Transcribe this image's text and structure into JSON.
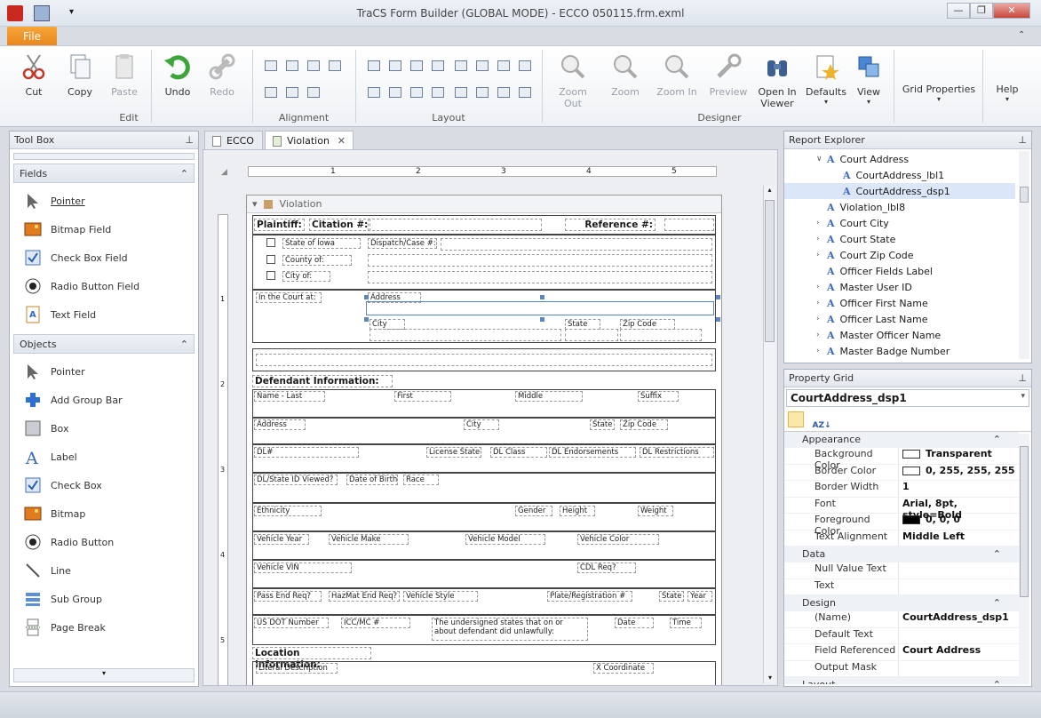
{
  "window": {
    "title": "TraCS Form Builder  (GLOBAL MODE) - ECCO 050115.frm.exml",
    "minimize": "—",
    "maximize": "❐",
    "close": "✕"
  },
  "file_tab": "File",
  "ribbon": {
    "buttons": [
      {
        "label": "Cut",
        "icon": "scissors-icon"
      },
      {
        "label": "Copy",
        "icon": "copy-icon"
      },
      {
        "label": "Paste",
        "icon": "paste-icon"
      },
      {
        "label": "Undo",
        "icon": "undo-icon"
      },
      {
        "label": "Redo",
        "icon": "redo-icon"
      },
      {
        "label": "Zoom Out",
        "icon": "zoom-out-icon"
      },
      {
        "label": "Zoom",
        "icon": "zoom-icon"
      },
      {
        "label": "Zoom In",
        "icon": "zoom-in-icon"
      },
      {
        "label": "Preview",
        "icon": "preview-icon"
      },
      {
        "label": "Open In Viewer",
        "icon": "binoculars-icon"
      },
      {
        "label": "Defaults",
        "icon": "defaults-icon"
      },
      {
        "label": "View",
        "icon": "view-icon"
      },
      {
        "label": "Grid Properties",
        "icon": ""
      },
      {
        "label": "Help",
        "icon": ""
      }
    ],
    "groups": [
      "Edit",
      "Alignment",
      "Layout",
      "Designer"
    ]
  },
  "toolbox": {
    "title": "Tool Box",
    "fields_header": "Fields",
    "fields": [
      {
        "label": "Pointer",
        "icon": "pointer-icon"
      },
      {
        "label": "Bitmap Field",
        "icon": "bitmap-icon"
      },
      {
        "label": "Check Box Field",
        "icon": "checkbox-icon"
      },
      {
        "label": "Radio Button Field",
        "icon": "radio-icon"
      },
      {
        "label": "Text Field",
        "icon": "text-field-icon"
      }
    ],
    "objects_header": "Objects",
    "objects": [
      {
        "label": "Pointer",
        "icon": "pointer-icon"
      },
      {
        "label": "Add Group Bar",
        "icon": "plus-icon"
      },
      {
        "label": "Box",
        "icon": "box-icon"
      },
      {
        "label": "Label",
        "icon": "label-icon"
      },
      {
        "label": "Check Box",
        "icon": "checkbox-icon"
      },
      {
        "label": "Bitmap",
        "icon": "bitmap-icon"
      },
      {
        "label": "Radio Button",
        "icon": "radio-icon"
      },
      {
        "label": "Line",
        "icon": "line-icon"
      },
      {
        "label": "Sub Group",
        "icon": "subgroup-icon"
      },
      {
        "label": "Page Break",
        "icon": "page-break-icon"
      }
    ]
  },
  "doc_tabs": [
    "ECCO",
    "Violation"
  ],
  "form": {
    "section_title": "Violation",
    "ruler_numbers": [
      "1",
      "2",
      "3",
      "4",
      "5"
    ],
    "vruler_numbers": [
      "1",
      "2",
      "3",
      "4",
      "5"
    ],
    "labels": {
      "plaintiff": "Plaintiff:",
      "citation": "Citation #:",
      "reference": "Reference #:",
      "state_of_iowa": "State of Iowa",
      "county_of": "County of:",
      "city_of": "City of:",
      "dispatch": "Dispatch/Case #:",
      "in_court_at": "In the Court at:",
      "address": "Address",
      "city": "City",
      "state": "State",
      "zip": "Zip Code",
      "defendant_info": "Defendant Information:",
      "name_last": "Name - Last",
      "first": "First",
      "middle": "Middle",
      "suffix": "Suffix",
      "def_address": "Address",
      "def_city": "City",
      "def_state": "State",
      "def_zip": "Zip Code",
      "dl": "DL#",
      "license_state": "License State",
      "dl_class": "DL Class",
      "dl_endorsements": "DL Endorsements",
      "dl_restrictions": "DL Restrictions",
      "dl_state_id": "DL/State ID Viewed?",
      "dob": "Date of Birth",
      "race": "Race",
      "ethnicity": "Ethnicity",
      "gender": "Gender",
      "height": "Height",
      "weight": "Weight",
      "vehicle_year": "Vehicle Year",
      "vehicle_make": "Vehicle Make",
      "vehicle_model": "Vehicle Model",
      "vehicle_color": "Vehicle Color",
      "vehicle_vin": "Vehicle VIN",
      "cdl_req": "CDL Req?",
      "pass_end": "Pass End Req?",
      "hazmat": "HazMat End Req?",
      "vehicle_style": "Vehicle Style",
      "plate": "Plate/Registration #",
      "v_state": "State",
      "v_year": "Year",
      "usdot": "US DOT Number",
      "iccmc": "ICC/MC #",
      "undersigned": "The undersigned states that on or about defendant did unlawfully:",
      "date": "Date",
      "time": "Time",
      "location_info": "Location Information:",
      "literal_desc": "Literal Description",
      "x_coord": "X Coordinate"
    }
  },
  "report_explorer": {
    "title": "Report Explorer",
    "items": [
      {
        "label": "Court Address",
        "indent": 2,
        "arrow": "∨"
      },
      {
        "label": "CourtAddress_lbl1",
        "indent": 3,
        "arrow": ""
      },
      {
        "label": "CourtAddress_dsp1",
        "indent": 3,
        "arrow": "",
        "selected": true
      },
      {
        "label": "Violation_lbl8",
        "indent": 2,
        "arrow": ""
      },
      {
        "label": "Court City",
        "indent": 2,
        "arrow": "›"
      },
      {
        "label": "Court State",
        "indent": 2,
        "arrow": "›"
      },
      {
        "label": "Court Zip Code",
        "indent": 2,
        "arrow": "›"
      },
      {
        "label": "Officer Fields Label",
        "indent": 2,
        "arrow": ""
      },
      {
        "label": "Master User ID",
        "indent": 2,
        "arrow": "›"
      },
      {
        "label": "Officer First Name",
        "indent": 2,
        "arrow": "›"
      },
      {
        "label": "Officer Last Name",
        "indent": 2,
        "arrow": "›"
      },
      {
        "label": "Master Officer Name",
        "indent": 2,
        "arrow": "›"
      },
      {
        "label": "Master Badge Number",
        "indent": 2,
        "arrow": "›"
      }
    ]
  },
  "property_grid": {
    "title": "Property Grid",
    "selected_object": "CourtAddress_dsp1",
    "categories": [
      {
        "name": "Appearance",
        "rows": [
          {
            "key": "Background Color",
            "value": "Transparent",
            "swatch": "#ffffff"
          },
          {
            "key": "Border Color",
            "value": "0, 255, 255, 255",
            "swatch": "#ffffff"
          },
          {
            "key": "Border Width",
            "value": "1",
            "swatch": ""
          },
          {
            "key": "Font",
            "value": "Arial, 8pt, style=Bold",
            "swatch": ""
          },
          {
            "key": "Foreground Color",
            "value": "0, 0, 0",
            "swatch": "#000000"
          },
          {
            "key": "Text Alignment",
            "value": "Middle Left",
            "swatch": ""
          }
        ]
      },
      {
        "name": "Data",
        "rows": [
          {
            "key": "Null Value Text",
            "value": "",
            "swatch": ""
          },
          {
            "key": "Text",
            "value": "",
            "swatch": ""
          }
        ]
      },
      {
        "name": "Design",
        "rows": [
          {
            "key": "(Name)",
            "value": "CourtAddress_dsp1",
            "swatch": ""
          },
          {
            "key": "Default Text",
            "value": "",
            "swatch": ""
          },
          {
            "key": "Field Referenced",
            "value": "Court Address",
            "swatch": ""
          },
          {
            "key": "Output Mask",
            "value": "",
            "swatch": ""
          }
        ]
      },
      {
        "name": "Layout",
        "rows": []
      }
    ]
  },
  "colors": {
    "accent": "#f29a2e",
    "selection": "#dbe7f8",
    "label_icon": "#3a66c4"
  }
}
